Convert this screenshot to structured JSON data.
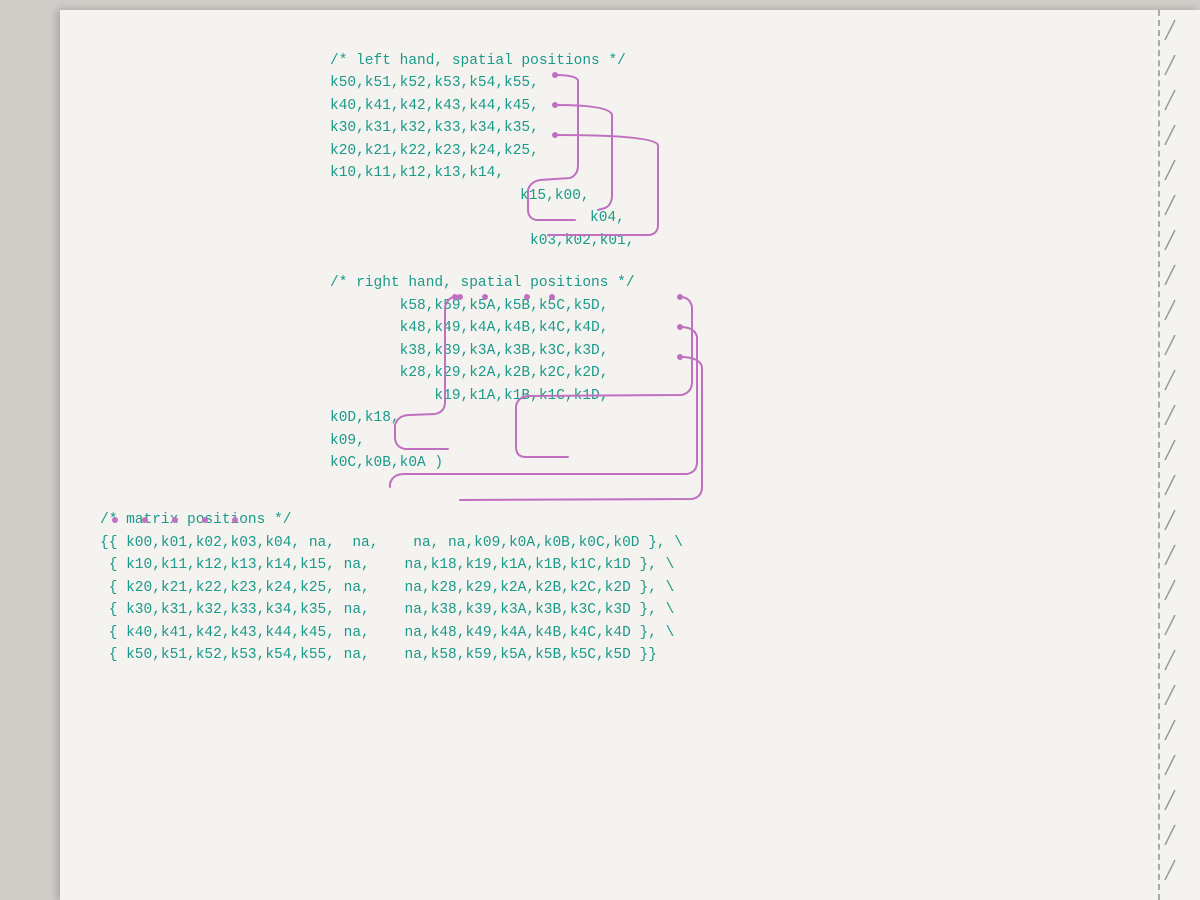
{
  "page": {
    "background": "#f5f3ef",
    "left_hand_comment": "/* left hand, spatial positions */",
    "left_hand_rows": [
      "k50,k51,k52,k53,k54,k55,",
      "k40,k41,k42,k43,k44,k45,",
      "k30,k31,k32,k33,k34,k35,",
      "k20,k21,k22,k23,k24,k25,",
      "k10,k11,k12,k13,k14,"
    ],
    "left_hand_continuation": [
      "                              k15,k00,",
      "                                  k04,",
      "                              k03,k02,k01,"
    ],
    "right_hand_comment": "/* right hand, spatial positions */",
    "right_hand_rows": [
      "        k58,k59,k5A,k5B,k5C,k5D,",
      "        k48,k49,k4A,k4B,k4C,k4D,",
      "        k38,k39,k3A,k3B,k3C,k3D,",
      "        k28,k29,k2A,k2B,k2C,k2D,",
      "            k19,k1A,k1B,k1C,k1D,"
    ],
    "right_hand_continuation": [
      "k0D,k18,",
      "k09,",
      "k0C,k0B,k0A )"
    ],
    "matrix_comment": "/* matrix positions */",
    "matrix_rows": [
      "{{ k00,k01,k02,k03,k04, na,  na,    na, na,k09,k0A,k0B,k0C,k0D },",
      " { k10,k11,k12,k13,k14,k15,  na,    na,k18,k19,k1A,k1B,k1C,k1D },",
      " { k20,k21,k22,k23,k24,k25,  na,    na,k28,k29,k2A,k2B,k2C,k2D },",
      " { k30,k31,k32,k33,k34,k35,  na,    na,k38,k39,k3A,k3B,k3C,k3D },",
      " { k40,k41,k42,k43,k44,k45,  na,    na,k48,k49,k4A,k4B,k4C,k4D },",
      " { k50,k51,k52,k53,k54,k55,  na,    na,k58,k59,k5A,k5B,k5C,k5D }}"
    ]
  }
}
